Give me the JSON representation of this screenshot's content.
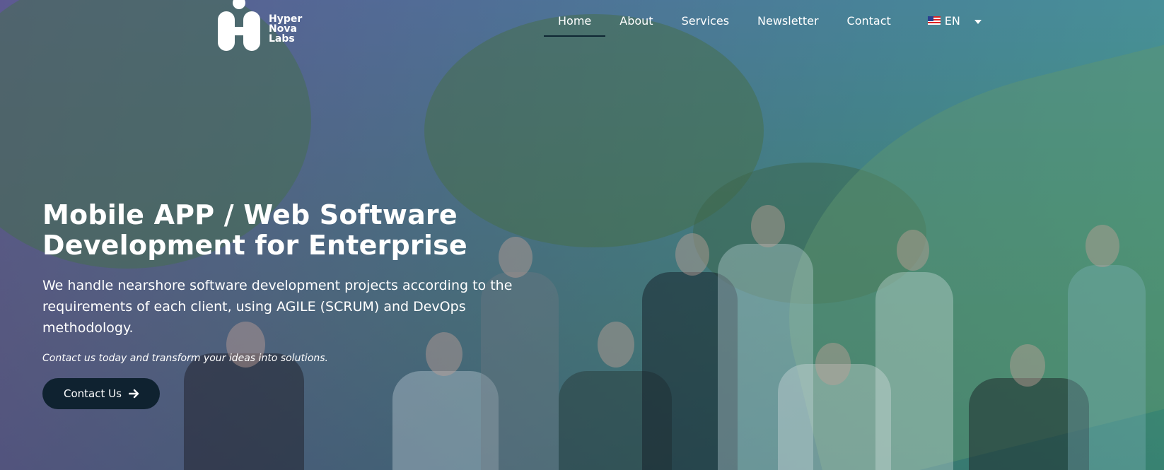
{
  "brand": {
    "name_lines": [
      "Hyper",
      "Nova",
      "Labs"
    ],
    "logo_icon": "hnl-logo-icon"
  },
  "nav": {
    "items": [
      {
        "label": "Home",
        "active": true
      },
      {
        "label": "About",
        "active": false
      },
      {
        "label": "Services",
        "active": false
      },
      {
        "label": "Newsletter",
        "active": false
      },
      {
        "label": "Contact",
        "active": false
      }
    ],
    "language": {
      "label": "EN",
      "icon": "us-flag-icon",
      "dropdown_icon": "caret-down-icon"
    }
  },
  "hero": {
    "headline_line1": "Mobile APP / Web Software",
    "headline_line2": "Development for Enterprise",
    "subtext": "We handle nearshore software development projects according to the requirements of each client, using AGILE (SCRUM) and DevOps methodology.",
    "tagline": "Contact us today and transform your ideas into solutions.",
    "cta_label": "Contact Us",
    "cta_icon": "arrow-right-icon"
  },
  "colors": {
    "overlay_start": "#584a8c",
    "overlay_end": "#2896a0",
    "cta_bg": "#0f2230",
    "active_underline": "#0f2733",
    "text": "#ffffff"
  }
}
